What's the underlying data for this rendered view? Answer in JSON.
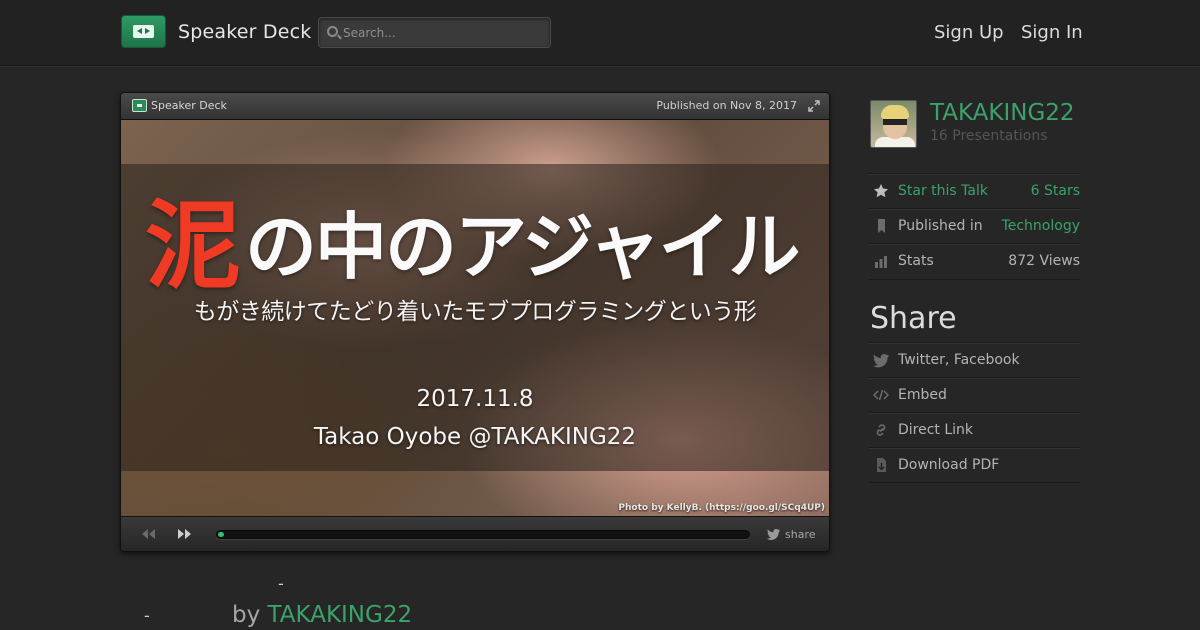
{
  "header": {
    "brand": "Speaker Deck",
    "search_placeholder": "Search...",
    "sign_up": "Sign Up",
    "sign_in": "Sign In"
  },
  "player": {
    "brand": "Speaker Deck",
    "published": "Published on Nov 8, 2017",
    "share_label": "share",
    "progress": 0.01,
    "slide": {
      "title_red": "泥",
      "title_white": "の中のアジャイル",
      "subtitle": "もがき続けてたどり着いたモブプログラミングという形",
      "date": "2017.11.8",
      "author": "Takao Oyobe @TAKAKING22",
      "photo_credit": "Photo by KellyB. (https://goo.gl/SCq4UP)"
    }
  },
  "below": {
    "dash1": "-",
    "dash2": "-",
    "by": "by ",
    "author": "TAKAKING22"
  },
  "sidebar": {
    "user_name": "TAKAKING22",
    "presentations": "16 Presentations",
    "star_label": "Star this Talk",
    "stars": "6 Stars",
    "published_label": "Published in",
    "category": "Technology",
    "stats_label": "Stats",
    "views": "872 Views",
    "share_heading": "Share",
    "share_links": [
      "Twitter, Facebook",
      "Embed",
      "Direct Link",
      "Download PDF"
    ]
  },
  "colors": {
    "accent_green": "#3aa36a",
    "title_red": "#f03a24",
    "background": "#262626"
  },
  "icons": [
    "search-icon",
    "expand-icon",
    "prev-icon",
    "next-icon",
    "twitter-bird-icon",
    "star-icon",
    "bookmark-icon",
    "bar-chart-icon",
    "code-icon",
    "link-icon",
    "download-icon"
  ]
}
